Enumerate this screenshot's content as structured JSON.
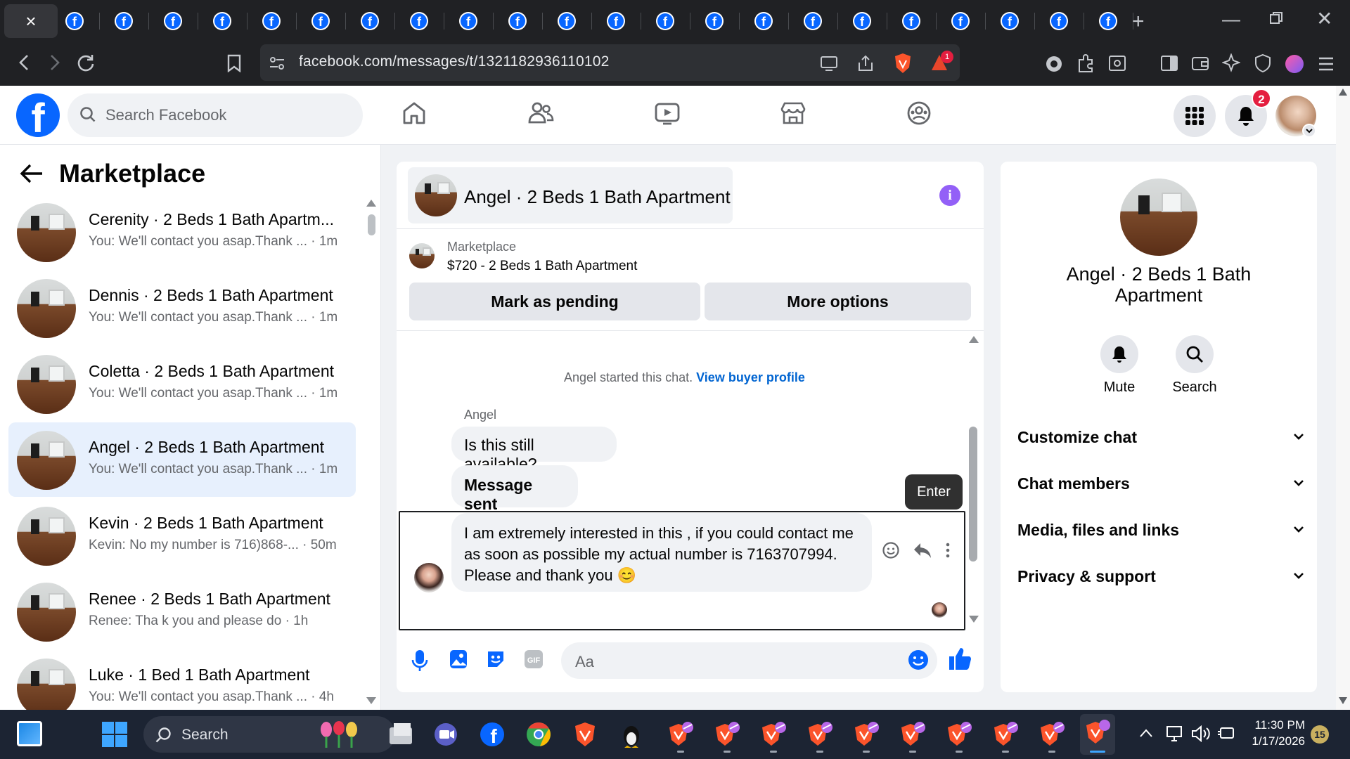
{
  "browser": {
    "url": "facebook.com/messages/t/1321182936110102",
    "tab_count_visible": 22,
    "tab_favicon": "f",
    "extension_badge": "1"
  },
  "facebook": {
    "logo_letter": "f",
    "search_placeholder": "Search Facebook",
    "notification_count": "2"
  },
  "sidebar": {
    "title": "Marketplace",
    "conversations": [
      {
        "name": "Cerenity · 2 Beds 1 Bath Apartm...",
        "snippet": "You: We'll contact you asap.Thank ... · 1m",
        "active": false
      },
      {
        "name": "Dennis · 2 Beds 1 Bath Apartment",
        "snippet": "You: We'll contact you asap.Thank ... · 1m",
        "active": false
      },
      {
        "name": "Coletta · 2 Beds 1 Bath Apartment",
        "snippet": "You: We'll contact you asap.Thank ... · 1m",
        "active": false
      },
      {
        "name": "Angel · 2 Beds 1 Bath Apartment",
        "snippet": "You: We'll contact you asap.Thank ... · 1m",
        "active": true
      },
      {
        "name": "Kevin · 2 Beds 1 Bath Apartment",
        "snippet": "Kevin: No my number is 716)868-... · 50m",
        "active": false
      },
      {
        "name": "Renee · 2 Beds 1 Bath Apartment",
        "snippet": "Renee: Tha k you and please do · 1h",
        "active": false
      },
      {
        "name": "Luke · 1 Bed 1 Bath Apartment",
        "snippet": "You: We'll contact you asap.Thank ... · 4h",
        "active": false
      }
    ]
  },
  "chat": {
    "title": "Angel · 2 Beds 1 Bath Apartment",
    "listing_label": "Marketplace",
    "listing_title": "$720 - 2 Beds 1 Bath Apartment",
    "mark_pending_label": "Mark as pending",
    "more_options_label": "More options",
    "started_text": "Angel started this chat.",
    "view_profile_link": "View buyer profile",
    "sender_name": "Angel",
    "message_1": "Is this still available?",
    "message_2": "Message sent",
    "message_3": "I am extremely interested in this , if you could contact me as soon as possible my actual number is 7163707994. Please and thank you 😊",
    "tooltip": "Enter",
    "composer_placeholder": "Aa"
  },
  "info_panel": {
    "name": "Angel · 2 Beds 1 Bath Apartment",
    "mute_label": "Mute",
    "search_label": "Search",
    "sections": [
      "Customize chat",
      "Chat members",
      "Media, files and links",
      "Privacy & support"
    ]
  },
  "taskbar": {
    "search_label": "Search",
    "time": "11:30 PM",
    "date": "1/17/2026",
    "tray_badge": "15"
  },
  "colors": {
    "fb_blue": "#0866ff",
    "active_row": "#e7f0fd",
    "link": "#0064d1",
    "info_purple": "#9360f7",
    "badge_red": "#e41e3f"
  }
}
